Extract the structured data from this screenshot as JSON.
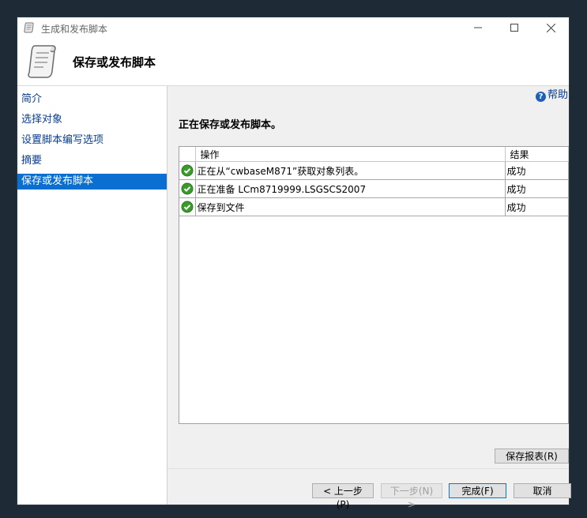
{
  "window": {
    "title": "生成和发布脚本"
  },
  "header": {
    "title": "保存或发布脚本"
  },
  "sidebar": {
    "items": [
      {
        "label": "简介"
      },
      {
        "label": "选择对象"
      },
      {
        "label": "设置脚本编写选项"
      },
      {
        "label": "摘要"
      },
      {
        "label": "保存或发布脚本"
      }
    ]
  },
  "main": {
    "help": "帮助",
    "status": "正在保存或发布脚本。",
    "columns": {
      "action": "操作",
      "result": "结果"
    },
    "rows": [
      {
        "action": "正在从“cwbaseM871”获取对象列表。",
        "result": "成功"
      },
      {
        "action": "正在准备 LCm8719999.LSGSCS2007",
        "result": "成功"
      },
      {
        "action": "保存到文件",
        "result": "成功"
      }
    ],
    "save_report": "保存报表(R)"
  },
  "footer": {
    "back": "< 上一步(P)",
    "next": "下一步(N) >",
    "finish": "完成(F)",
    "cancel": "取消"
  },
  "colors": {
    "accent": "#0a6fd1",
    "success": "#3a9a2a"
  }
}
